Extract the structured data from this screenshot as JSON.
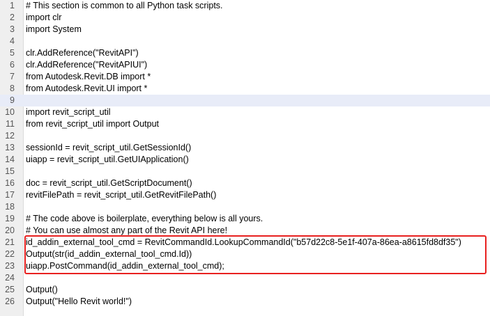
{
  "editor": {
    "current_line": 9,
    "highlight_color": "#e8201f",
    "current_line_color": "#e8ecf8",
    "lines": [
      {
        "num": "1",
        "text": "# This section is common to all Python task scripts."
      },
      {
        "num": "2",
        "text": "import clr"
      },
      {
        "num": "3",
        "text": "import System"
      },
      {
        "num": "4",
        "text": ""
      },
      {
        "num": "5",
        "text": "clr.AddReference(\"RevitAPI\")"
      },
      {
        "num": "6",
        "text": "clr.AddReference(\"RevitAPIUI\")"
      },
      {
        "num": "7",
        "text": "from Autodesk.Revit.DB import *"
      },
      {
        "num": "8",
        "text": "from Autodesk.Revit.UI import *"
      },
      {
        "num": "9",
        "text": ""
      },
      {
        "num": "10",
        "text": "import revit_script_util"
      },
      {
        "num": "11",
        "text": "from revit_script_util import Output"
      },
      {
        "num": "12",
        "text": ""
      },
      {
        "num": "13",
        "text": "sessionId = revit_script_util.GetSessionId()"
      },
      {
        "num": "14",
        "text": "uiapp = revit_script_util.GetUIApplication()"
      },
      {
        "num": "15",
        "text": ""
      },
      {
        "num": "16",
        "text": "doc = revit_script_util.GetScriptDocument()"
      },
      {
        "num": "17",
        "text": "revitFilePath = revit_script_util.GetRevitFilePath()"
      },
      {
        "num": "18",
        "text": ""
      },
      {
        "num": "19",
        "text": "# The code above is boilerplate, everything below is all yours."
      },
      {
        "num": "20",
        "text": "# You can use almost any part of the Revit API here!"
      },
      {
        "num": "21",
        "text": "id_addin_external_tool_cmd = RevitCommandId.LookupCommandId(\"b57d22c8-5e1f-407a-86ea-a8615fd8df35\")"
      },
      {
        "num": "22",
        "text": "Output(str(id_addin_external_tool_cmd.Id))"
      },
      {
        "num": "23",
        "text": "uiapp.PostCommand(id_addin_external_tool_cmd);"
      },
      {
        "num": "24",
        "text": ""
      },
      {
        "num": "25",
        "text": "Output()"
      },
      {
        "num": "26",
        "text": "Output(\"Hello Revit world!\")"
      }
    ]
  }
}
